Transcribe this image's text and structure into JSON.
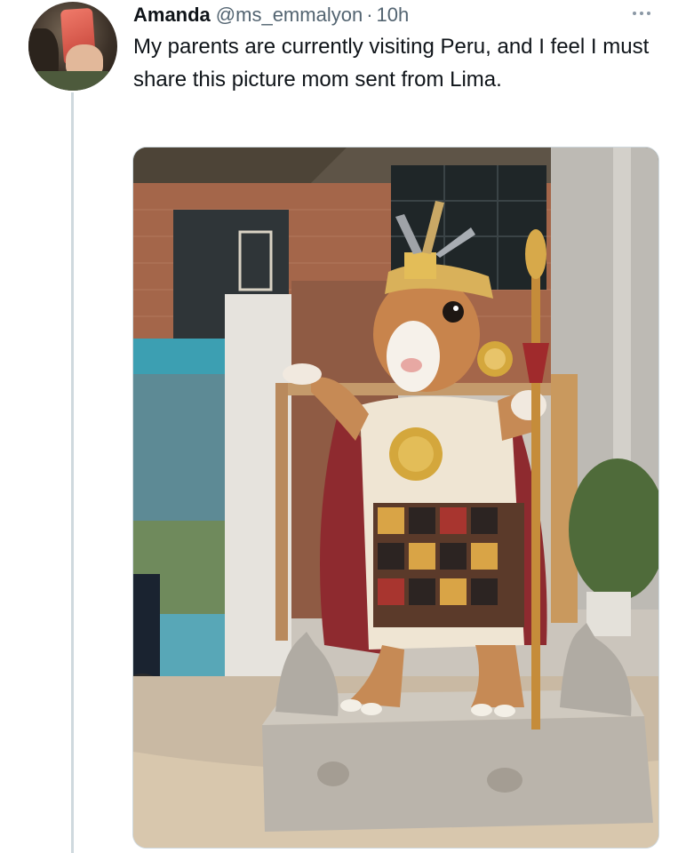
{
  "tweet": {
    "display_name": "Amanda",
    "handle": "@ms_emmalyon",
    "separator": "·",
    "time": "10h",
    "text": "My parents are currently visiting Peru, and I feel I must share this picture mom sent from Lima."
  },
  "media": {
    "description_icon": "photo",
    "alt": "Statue of a guinea pig dressed as an Inca king on a stone pedestal"
  },
  "icons": {
    "more": "more-horizontal-icon"
  }
}
